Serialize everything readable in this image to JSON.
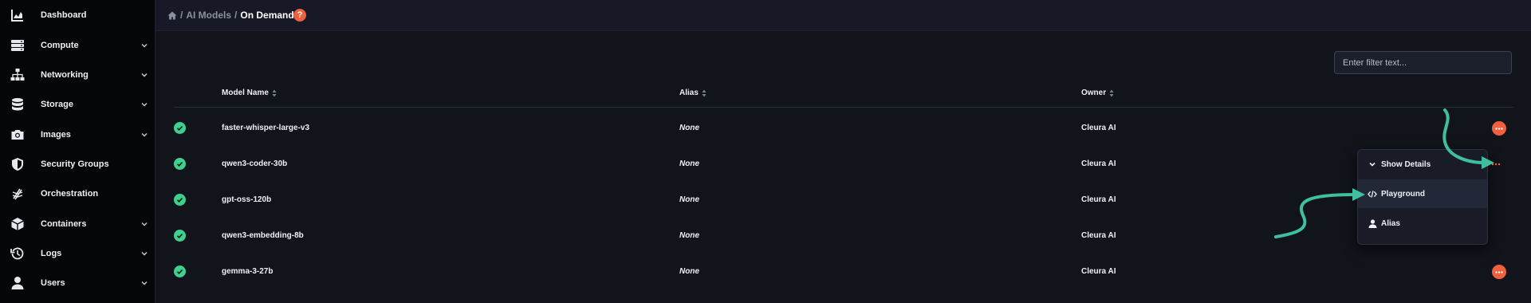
{
  "sidebar": {
    "items": [
      {
        "label": "Dashboard",
        "icon": "chart-area-icon",
        "has_children": false
      },
      {
        "label": "Compute",
        "icon": "server-icon",
        "has_children": true
      },
      {
        "label": "Networking",
        "icon": "sitemap-icon",
        "has_children": true
      },
      {
        "label": "Storage",
        "icon": "database-icon",
        "has_children": true
      },
      {
        "label": "Images",
        "icon": "camera-icon",
        "has_children": true
      },
      {
        "label": "Security Groups",
        "icon": "shield-icon",
        "has_children": false
      },
      {
        "label": "Orchestration",
        "icon": "layers-icon",
        "has_children": false
      },
      {
        "label": "Containers",
        "icon": "cube-icon",
        "has_children": true
      },
      {
        "label": "Logs",
        "icon": "history-icon",
        "has_children": true
      },
      {
        "label": "Users",
        "icon": "user-icon",
        "has_children": true
      }
    ]
  },
  "breadcrumb": {
    "home_icon": "home-icon",
    "sep": "/",
    "parent": "AI Models",
    "current": "On Demand",
    "help": "?"
  },
  "filter": {
    "placeholder": "Enter filter text...",
    "value": ""
  },
  "table": {
    "columns": {
      "name": "Model Name",
      "alias": "Alias",
      "owner": "Owner"
    },
    "rows": [
      {
        "name": "faster-whisper-large-v3",
        "alias": "None",
        "owner": "Cleura AI",
        "status": "ok"
      },
      {
        "name": "qwen3-coder-30b",
        "alias": "None",
        "owner": "Cleura AI",
        "status": "ok"
      },
      {
        "name": "gpt-oss-120b",
        "alias": "None",
        "owner": "Cleura AI",
        "status": "ok"
      },
      {
        "name": "qwen3-embedding-8b",
        "alias": "None",
        "owner": "Cleura AI",
        "status": "ok"
      },
      {
        "name": "gemma-3-27b",
        "alias": "None",
        "owner": "Cleura AI",
        "status": "ok"
      }
    ]
  },
  "menu": {
    "items": [
      {
        "label": "Show Details",
        "icon": "chevron-down-icon"
      },
      {
        "label": "Playground",
        "icon": "code-icon"
      },
      {
        "label": "Alias",
        "icon": "user-icon"
      }
    ]
  },
  "colors": {
    "accent": "#f0603f",
    "success": "#3fcf8e",
    "annotation": "#3fbfa0",
    "sidebar_bg": "#050608",
    "main_bg": "#12141c"
  }
}
